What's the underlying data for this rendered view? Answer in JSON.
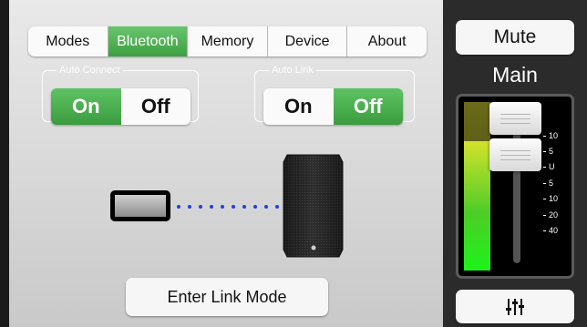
{
  "tabs": [
    {
      "label": "Modes",
      "active": false
    },
    {
      "label": "Bluetooth",
      "active": true
    },
    {
      "label": "Memory",
      "active": false
    },
    {
      "label": "Device",
      "active": false
    },
    {
      "label": "About",
      "active": false
    }
  ],
  "auto_connect": {
    "legend": "Auto Connect",
    "on_label": "On",
    "off_label": "Off",
    "selected": "On"
  },
  "auto_link": {
    "legend": "Auto Link",
    "on_label": "On",
    "off_label": "Off",
    "selected": "Off"
  },
  "link_button": {
    "label": "Enter Link Mode"
  },
  "channel": {
    "mute_label": "Mute",
    "name": "Main",
    "scale_labels": [
      "10",
      "5",
      "U",
      "5",
      "10",
      "20",
      "40"
    ],
    "meter_level": 0.77,
    "settings_icon": "mixer-sliders-icon"
  },
  "colors": {
    "active_green": "#4caf50",
    "link_dots": "#1f3fe0",
    "meter_green": "#1df31b"
  }
}
